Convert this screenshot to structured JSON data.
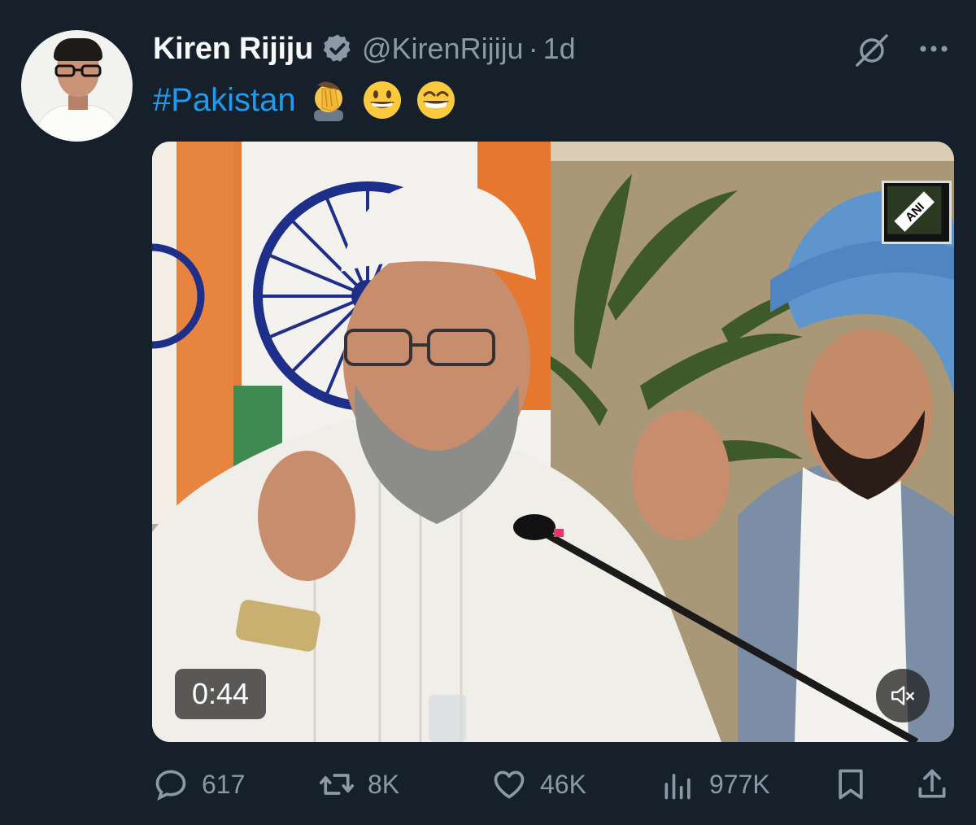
{
  "tweet": {
    "author_name": "Kiren Rijiju",
    "handle": "@KirenRijiju",
    "separator": "·",
    "time": "1d",
    "hashtag": "#Pakistan",
    "emojis": [
      "face-palm-emoji",
      "grinning-face-emoji",
      "beaming-face-emoji"
    ],
    "video": {
      "duration": "0:44",
      "watermark": "ANI"
    }
  },
  "actions": {
    "replies": "617",
    "retweets": "8K",
    "likes": "46K",
    "views": "977K"
  },
  "colors": {
    "background": "#15202b",
    "text": "#f7f9f9",
    "muted": "#8b98a5",
    "accent": "#1d9bf0"
  },
  "icons": {
    "verified": "verified-badge-icon",
    "grok": "grok-icon",
    "more": "more-options-icon",
    "reply": "reply-icon",
    "retweet": "retweet-icon",
    "like": "heart-icon",
    "views": "views-chart-icon",
    "bookmark": "bookmark-icon",
    "share": "share-icon",
    "mute": "muted-speaker-icon"
  }
}
